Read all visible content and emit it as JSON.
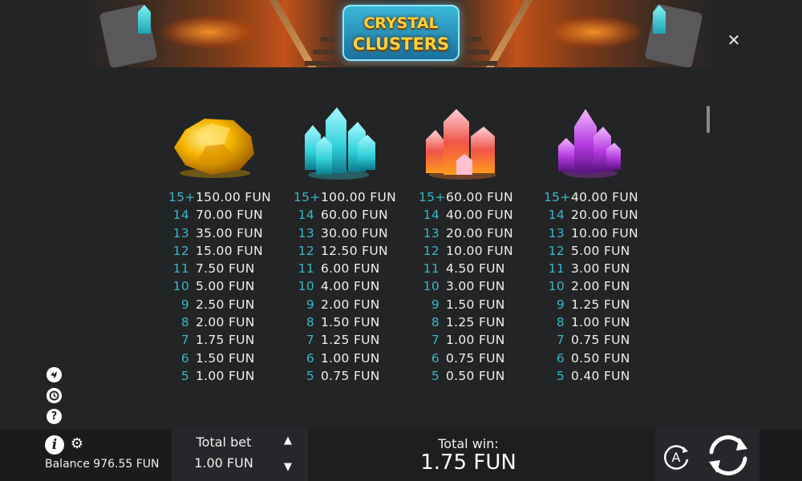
{
  "header": {
    "logo_line1": "CRYSTAL",
    "logo_line2": "CLUSTERS",
    "close_label": "✕"
  },
  "paytable": [
    {
      "symbol": "yellow-gem-icon",
      "color": "#f5b400",
      "rows": [
        {
          "count": "15+",
          "value": "150.00 FUN"
        },
        {
          "count": "14",
          "value": "70.00 FUN"
        },
        {
          "count": "13",
          "value": "35.00 FUN"
        },
        {
          "count": "12",
          "value": "15.00 FUN"
        },
        {
          "count": "11",
          "value": "7.50 FUN"
        },
        {
          "count": "10",
          "value": "5.00 FUN"
        },
        {
          "count": "9",
          "value": "2.50 FUN"
        },
        {
          "count": "8",
          "value": "2.00 FUN"
        },
        {
          "count": "7",
          "value": "1.75 FUN"
        },
        {
          "count": "6",
          "value": "1.50 FUN"
        },
        {
          "count": "5",
          "value": "1.00 FUN"
        }
      ]
    },
    {
      "symbol": "cyan-crystal-icon",
      "color": "#2fd0d8",
      "rows": [
        {
          "count": "15+",
          "value": "100.00 FUN"
        },
        {
          "count": "14",
          "value": "60.00 FUN"
        },
        {
          "count": "13",
          "value": "30.00 FUN"
        },
        {
          "count": "12",
          "value": "12.50 FUN"
        },
        {
          "count": "11",
          "value": "6.00 FUN"
        },
        {
          "count": "10",
          "value": "4.00 FUN"
        },
        {
          "count": "9",
          "value": "2.00 FUN"
        },
        {
          "count": "8",
          "value": "1.50 FUN"
        },
        {
          "count": "7",
          "value": "1.25 FUN"
        },
        {
          "count": "6",
          "value": "1.00 FUN"
        },
        {
          "count": "5",
          "value": "0.75 FUN"
        }
      ]
    },
    {
      "symbol": "red-crystal-icon",
      "color": "#f0554a",
      "rows": [
        {
          "count": "15+",
          "value": "60.00 FUN"
        },
        {
          "count": "14",
          "value": "40.00 FUN"
        },
        {
          "count": "13",
          "value": "20.00 FUN"
        },
        {
          "count": "12",
          "value": "10.00 FUN"
        },
        {
          "count": "11",
          "value": "4.50 FUN"
        },
        {
          "count": "10",
          "value": "3.00 FUN"
        },
        {
          "count": "9",
          "value": "1.50 FUN"
        },
        {
          "count": "8",
          "value": "1.25 FUN"
        },
        {
          "count": "7",
          "value": "1.00 FUN"
        },
        {
          "count": "6",
          "value": "0.75 FUN"
        },
        {
          "count": "5",
          "value": "0.50 FUN"
        }
      ]
    },
    {
      "symbol": "purple-crystal-icon",
      "color": "#b53ae0",
      "rows": [
        {
          "count": "15+",
          "value": "40.00 FUN"
        },
        {
          "count": "14",
          "value": "20.00 FUN"
        },
        {
          "count": "13",
          "value": "10.00 FUN"
        },
        {
          "count": "12",
          "value": "5.00 FUN"
        },
        {
          "count": "11",
          "value": "3.00 FUN"
        },
        {
          "count": "10",
          "value": "2.00 FUN"
        },
        {
          "count": "9",
          "value": "1.25 FUN"
        },
        {
          "count": "8",
          "value": "1.00 FUN"
        },
        {
          "count": "7",
          "value": "0.75 FUN"
        },
        {
          "count": "6",
          "value": "0.50 FUN"
        },
        {
          "count": "5",
          "value": "0.40 FUN"
        }
      ]
    }
  ],
  "side_icons": [
    "fast-play-icon",
    "history-icon",
    "help-icon"
  ],
  "footer": {
    "balance": "Balance 976.55 FUN",
    "total_bet_label": "Total bet",
    "total_bet_value": "1.00 FUN",
    "total_win_label": "Total win:",
    "total_win_value": "1.75 FUN",
    "autoplay_letter": "A"
  },
  "colors": {
    "background": "#232425",
    "count_accent": "#38b6c9",
    "bottom_bar": "#1a1b1c"
  }
}
